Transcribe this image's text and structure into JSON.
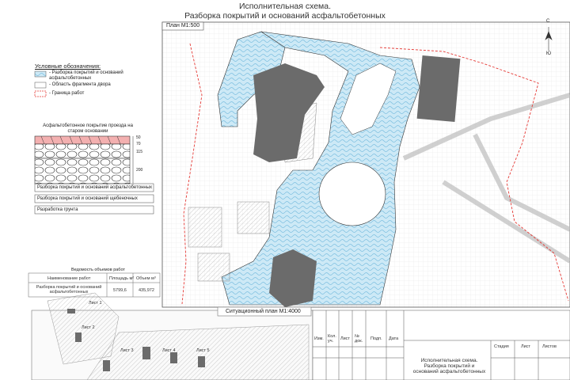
{
  "header": {
    "title_line1": "Исполнительная схема.",
    "title_line2": "Разборка покрытий и оснований асфальтобетонных"
  },
  "plan": {
    "label": "План М1:500"
  },
  "situation": {
    "label": "Ситуационный план М1:4000"
  },
  "north": {
    "top": "С",
    "bottom": "Ю"
  },
  "legend": {
    "title": "Условные обозначения:",
    "items": [
      {
        "text": "- Разборка покрытий и оснований асфальтобетонных",
        "swatch": "#bfe3f5"
      },
      {
        "text": "- Область фрагмента двора",
        "swatch": "#ffffff"
      },
      {
        "text": "- Граница работ",
        "swatch": "#e53935"
      }
    ]
  },
  "section": {
    "title": "Асфальтобетонное покрытие проезда на старом основании",
    "dims": [
      "50",
      "70",
      "115",
      "200"
    ],
    "rows": [
      "Разборка покрытий и оснований асфальтобетонных",
      "Разборка покрытий и оснований щебеночных",
      "Разработка грунта"
    ]
  },
  "volumes": {
    "title": "Ведомость объемов работ",
    "headers": [
      "Наименование работ",
      "Площадь м²",
      "Объем м³"
    ],
    "rows": [
      {
        "name": "Разборка покрытий и оснований асфальтобетонных",
        "area": "5799,6",
        "volume": "435,972"
      }
    ]
  },
  "sheets": [
    "Лист 1",
    "Лист 2",
    "Лист 3",
    "Лист 4",
    "Лист 5"
  ],
  "stamp": {
    "cols": [
      "Изм.",
      "Кол. уч.",
      "Лист",
      "№ док.",
      "Подп.",
      "Дата"
    ],
    "right_headers": [
      "Стадия",
      "Лист",
      "Листов"
    ],
    "desc": "Исполнительная схема. Разборка покрытий и оснований асфальтобетонных"
  },
  "colors": {
    "asphalt": "#c9e7f5",
    "building": "#6b6b6b",
    "border": "#e53935",
    "grid": "#e3e3e3"
  }
}
